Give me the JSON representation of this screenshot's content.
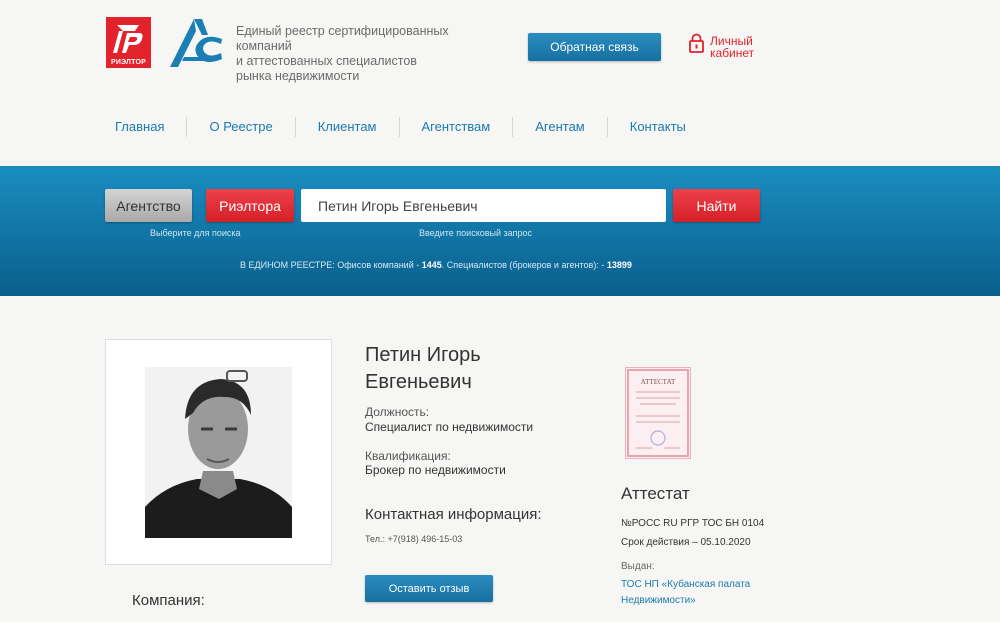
{
  "header": {
    "logo_rgr_caption": "РИЭЛТОР",
    "registry_title_lines": [
      "Единый реестр сертифицированных",
      "компаний",
      "и аттестованных специалистов",
      "рынка недвижимости"
    ],
    "feedback_label": "Обратная связь",
    "cabinet_line1": "Личный",
    "cabinet_line2": "кабинет"
  },
  "nav": {
    "items": [
      "Главная",
      "О Реестре",
      "Клиентам",
      "Агентствам",
      "Агентам",
      "Контакты"
    ]
  },
  "search": {
    "agency_label": "Агентство",
    "realtor_label": "Риэлтора",
    "query_value": "Петин Игорь Евгеньевич",
    "find_label": "Найти",
    "hint_choose": "Выберите для поиска",
    "hint_query": "Введите поисковый запрос"
  },
  "stats": {
    "prefix": "В ЕДИНОМ РЕЕСТРЕ: Офисов компаний - ",
    "offices": "1445",
    "middle": ". Специалистов (брокеров и агентов): - ",
    "specialists": "13899"
  },
  "profile": {
    "name": "Петин Игорь Евгеньевич",
    "position_label": "Должность:",
    "position_value": "Специалист по недвижимости",
    "qualification_label": "Квалификация:",
    "qualification_value": "Брокер по недвижимости",
    "contact_title": "Контактная информация:",
    "phone": "Тел.: +7(918) 496-15-03",
    "review_label": "Оставить отзыв",
    "company_label": "Компания:"
  },
  "certificate": {
    "thumb_caption": "АТТЕСТАТ",
    "title": "Аттестат",
    "number": "№РОСС RU РГР ТОС БН 0104",
    "valid": "Срок действия – 05.10.2020",
    "issued_label": "Выдан:",
    "issuer": "ТОС НП «Кубанская палата Недвижимости»"
  },
  "colors": {
    "brand_red": "#e3232b",
    "brand_blue": "#1d7ab0",
    "band_top": "#1a8dc0",
    "band_bottom": "#0a5f8c"
  }
}
